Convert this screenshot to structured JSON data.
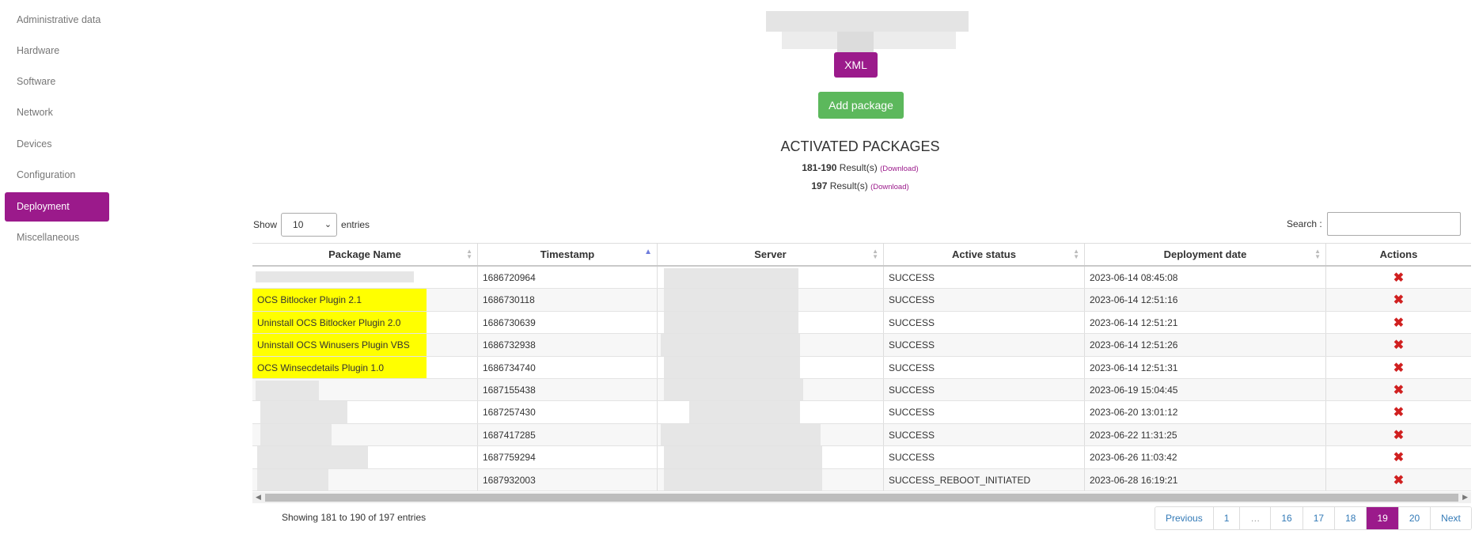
{
  "sidebar": {
    "items": [
      {
        "label": "Administrative data",
        "active": false
      },
      {
        "label": "Hardware",
        "active": false
      },
      {
        "label": "Software",
        "active": false
      },
      {
        "label": "Network",
        "active": false
      },
      {
        "label": "Devices",
        "active": false
      },
      {
        "label": "Configuration",
        "active": false
      },
      {
        "label": "Deployment",
        "active": true
      },
      {
        "label": "Miscellaneous",
        "active": false
      }
    ]
  },
  "buttons": {
    "xml_label": "XML",
    "add_package_label": "Add package"
  },
  "section_title": "ACTIVATED PACKAGES",
  "results": {
    "range": "181-190",
    "range_suffix": "Result(s)",
    "total": "197",
    "total_suffix": "Result(s)",
    "download_label": "(Download)"
  },
  "length_control": {
    "show_label": "Show",
    "selected": "10",
    "entries_label": "entries"
  },
  "search": {
    "label": "Search :",
    "value": ""
  },
  "table": {
    "columns": [
      "Package Name",
      "Timestamp",
      "Server",
      "Active status",
      "Deployment date",
      "Actions"
    ],
    "sorted_column": "Timestamp",
    "rows": [
      {
        "name": "",
        "name_highlight": false,
        "timestamp": "1686720964",
        "status": "SUCCESS",
        "date": "2023-06-14 08:45:08"
      },
      {
        "name": "OCS Bitlocker Plugin 2.1",
        "name_highlight": true,
        "timestamp": "1686730118",
        "status": "SUCCESS",
        "date": "2023-06-14 12:51:16"
      },
      {
        "name": "Uninstall OCS Bitlocker Plugin 2.0",
        "name_highlight": true,
        "timestamp": "1686730639",
        "status": "SUCCESS",
        "date": "2023-06-14 12:51:21"
      },
      {
        "name": "Uninstall OCS Winusers Plugin VBS",
        "name_highlight": true,
        "timestamp": "1686732938",
        "status": "SUCCESS",
        "date": "2023-06-14 12:51:26"
      },
      {
        "name": "OCS Winsecdetails Plugin 1.0",
        "name_highlight": true,
        "timestamp": "1686734740",
        "status": "SUCCESS",
        "date": "2023-06-14 12:51:31"
      },
      {
        "name": "",
        "name_highlight": false,
        "timestamp": "1687155438",
        "status": "SUCCESS",
        "date": "2023-06-19 15:04:45"
      },
      {
        "name": "",
        "name_highlight": false,
        "timestamp": "1687257430",
        "status": "SUCCESS",
        "date": "2023-06-20 13:01:12"
      },
      {
        "name": "",
        "name_highlight": false,
        "timestamp": "1687417285",
        "status": "SUCCESS",
        "date": "2023-06-22 11:31:25"
      },
      {
        "name": "",
        "name_highlight": false,
        "timestamp": "1687759294",
        "status": "SUCCESS",
        "date": "2023-06-26 11:03:42"
      },
      {
        "name": "",
        "name_highlight": false,
        "timestamp": "1687932003",
        "status": "SUCCESS_REBOOT_INITIATED",
        "date": "2023-06-28 16:19:21"
      }
    ]
  },
  "footer": {
    "info": "Showing 181 to 190 of 197 entries"
  },
  "pagination": {
    "previous": "Previous",
    "pages": [
      "1",
      "…",
      "16",
      "17",
      "18",
      "19",
      "20"
    ],
    "current": "19",
    "next": "Next"
  },
  "colors": {
    "accent": "#9b1a8b",
    "add_button": "#5cb85c",
    "highlight": "#ffff00",
    "delete_icon": "#d02020"
  },
  "icons": {
    "delete": "red-x-icon",
    "sort": "sort-arrows-icon"
  }
}
